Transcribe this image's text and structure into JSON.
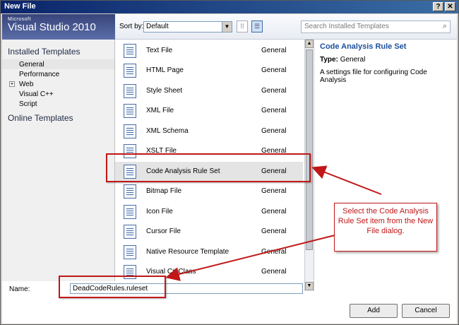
{
  "window": {
    "title": "New File",
    "help_label": "?",
    "close_label": "✕"
  },
  "banner": {
    "small": "Microsoft",
    "big": "Visual Studio 2010"
  },
  "left_nav": {
    "installed_header": "Installed Templates",
    "items": [
      {
        "label": "General",
        "expander": ""
      },
      {
        "label": "Performance",
        "expander": ""
      },
      {
        "label": "Web",
        "expander": "+"
      },
      {
        "label": "Visual C++",
        "expander": ""
      },
      {
        "label": "Script",
        "expander": ""
      }
    ],
    "online_header": "Online Templates"
  },
  "toolbar": {
    "sort_label": "Sort by:",
    "sort_value": "Default",
    "search_placeholder": "Search Installed Templates"
  },
  "templates": [
    {
      "name": "Text File",
      "category": "General",
      "icon": "text-file-icon"
    },
    {
      "name": "HTML Page",
      "category": "General",
      "icon": "html-page-icon"
    },
    {
      "name": "Style Sheet",
      "category": "General",
      "icon": "style-sheet-icon"
    },
    {
      "name": "XML File",
      "category": "General",
      "icon": "xml-file-icon"
    },
    {
      "name": "XML Schema",
      "category": "General",
      "icon": "xml-schema-icon"
    },
    {
      "name": "XSLT File",
      "category": "General",
      "icon": "xslt-file-icon"
    },
    {
      "name": "Code Analysis Rule Set",
      "category": "General",
      "icon": "rule-set-icon"
    },
    {
      "name": "Bitmap File",
      "category": "General",
      "icon": "bitmap-file-icon"
    },
    {
      "name": "Icon File",
      "category": "General",
      "icon": "icon-file-icon"
    },
    {
      "name": "Cursor File",
      "category": "General",
      "icon": "cursor-file-icon"
    },
    {
      "name": "Native Resource Template",
      "category": "General",
      "icon": "resource-template-icon"
    },
    {
      "name": "Visual C# Class",
      "category": "General",
      "icon": "csharp-class-icon"
    }
  ],
  "details": {
    "title": "Code Analysis Rule Set",
    "type_label": "Type:",
    "type_value": "General",
    "description": "A settings file for configuring Code Analysis"
  },
  "name_field": {
    "label": "Name:",
    "value": "DeadCodeRules.ruleset"
  },
  "buttons": {
    "add": "Add",
    "cancel": "Cancel"
  },
  "annotation": {
    "text": "Select the Code Analysis Rule Set item from the New File dialog."
  },
  "colors": {
    "annotation_red": "#c01818",
    "title_link": "#1e4f9c"
  }
}
